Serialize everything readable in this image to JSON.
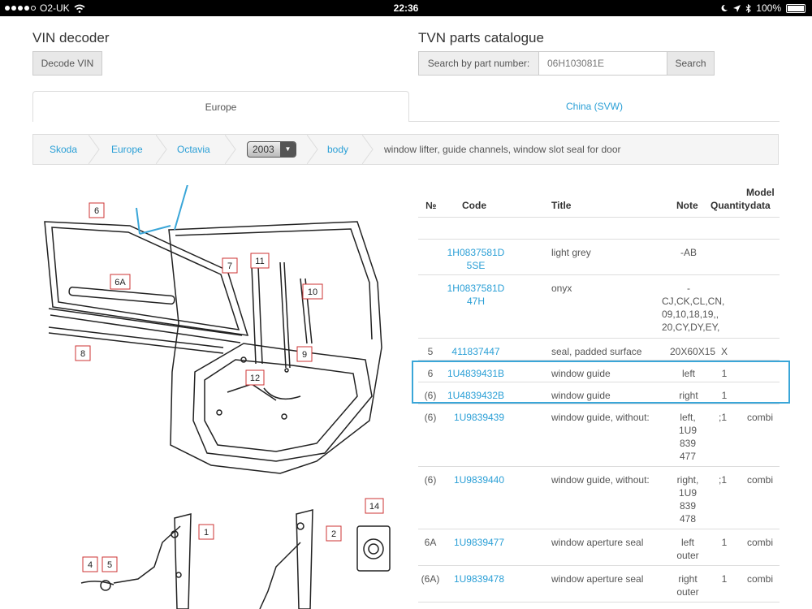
{
  "statusbar": {
    "carrier": "O2-UK",
    "time": "22:36",
    "battery": "100%",
    "battery_level": 1.0
  },
  "vin": {
    "title": "VIN decoder",
    "button": "Decode VIN"
  },
  "catalogue": {
    "title": "TVN parts catalogue",
    "search_label": "Search by part number:",
    "search_value": "06H103081E",
    "search_button": "Search"
  },
  "tabs": [
    {
      "label": "Europe",
      "active": true
    },
    {
      "label": "China (SVW)",
      "active": false
    }
  ],
  "breadcrumb": {
    "items": [
      "Skoda",
      "Europe",
      "Octavia"
    ],
    "year": "2003",
    "section": "body",
    "current": "window lifter, guide channels, window slot seal for door"
  },
  "diagram": {
    "callouts": [
      "6",
      "6A",
      "7",
      "11",
      "10",
      "8",
      "9",
      "12",
      "1",
      "2",
      "14",
      "4",
      "5"
    ]
  },
  "table": {
    "headers": {
      "no": "№",
      "code": "Code",
      "title": "Title",
      "note": "Note",
      "qty": "Quantity",
      "model1": "Model",
      "model2": "data"
    },
    "rows": [
      {
        "no": "",
        "code1": "1H0837581D",
        "code2": "5SE",
        "title": "light grey",
        "note": "-AB",
        "qty": "",
        "model": ""
      },
      {
        "no": "",
        "code1": "1H0837581D",
        "code2": "47H",
        "title": "onyx",
        "note1": "-",
        "note2": "CJ,CK,CL,CN,",
        "note3": "09,10,18,19,,",
        "note4": "20,CY,DY,EY,",
        "qty": "",
        "model": ""
      },
      {
        "no": "5",
        "code": "411837447",
        "title": "seal, padded surface",
        "note": "20X60X15",
        "qty": "X",
        "model": ""
      },
      {
        "no": "6",
        "code": "1U4839431B",
        "title": "window guide",
        "note": "left",
        "qty": "1",
        "model": ""
      },
      {
        "no": "(6)",
        "code": "1U4839432B",
        "title": "window guide",
        "note": "right",
        "qty": "1",
        "model": ""
      },
      {
        "no": "(6)",
        "code": "1U9839439",
        "title": "window guide, without:",
        "note1": "left,",
        "note2": "1U9",
        "note3": "839",
        "note4": "477",
        "qty": ";1",
        "model": "combi"
      },
      {
        "no": "(6)",
        "code": "1U9839440",
        "title": "window guide, without:",
        "note1": "right,",
        "note2": "1U9",
        "note3": "839",
        "note4": "478",
        "qty": ";1",
        "model": "combi"
      },
      {
        "no": "6A",
        "code": "1U9839477",
        "title": "window aperture seal",
        "note1": "left",
        "note2": "outer",
        "qty": "1",
        "model": "combi"
      },
      {
        "no": "(6A)",
        "code": "1U9839478",
        "title": "window aperture seal",
        "note1": "right",
        "note2": "outer",
        "qty": "1",
        "model": "combi"
      }
    ]
  },
  "colors": {
    "link": "#2a9fd6",
    "highlight": "#3aa6d8"
  }
}
